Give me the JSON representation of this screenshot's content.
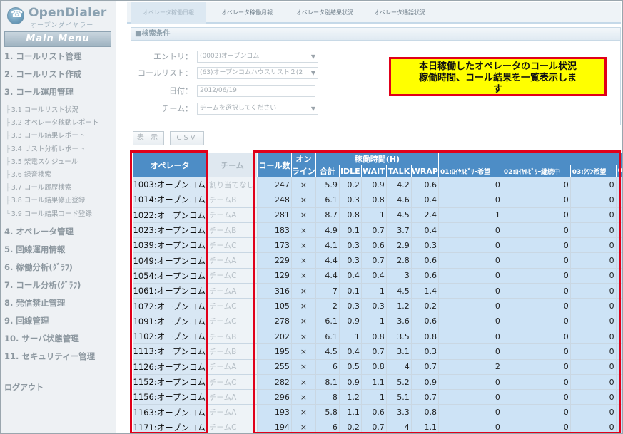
{
  "logo": {
    "name": "OpenDialer",
    "sub": "オープンダイヤラー"
  },
  "sidebar": {
    "main_menu": "Main Menu",
    "groups": [
      "1. コールリスト管理",
      "2. コールリスト作成",
      "3. コール運用管理",
      "4. オペレータ管理",
      "5. 回線運用情報",
      "6. 稼働分析(ｸﾞﾗﾌ)",
      "7. コール分析(ｸﾞﾗﾌ)",
      "8. 発信禁止管理",
      "9. 回線管理",
      "10. サーバ状態管理",
      "11. セキュリティー管理"
    ],
    "sub_items": [
      "3.1 コールリスト状況",
      "3.2 オペレータ稼動レポート",
      "3.3 コール結果レポート",
      "3.4 リスト分析レポート",
      "3.5 架電スケジュール",
      "3.6 録音検索",
      "3.7 コール履歴検索",
      "3.8 コール結果修正登録",
      "3.9 コール結果コード登録"
    ],
    "logout": "ログアウト"
  },
  "tabs": [
    "オペレータ稼働日報",
    "オペレータ稼働月報",
    "オペレータ別結果状況",
    "オペレータ通話状況"
  ],
  "search": {
    "header": "■検索条件",
    "entry_label": "エントリ：",
    "entry_value": "(0002)オープンコム",
    "list_label": "コールリスト：",
    "list_value": "(63)オープンコムハウスリスト２(2",
    "date_label": "日付：",
    "date_value": "2012/06/19",
    "team_label": "チーム：",
    "team_value": "チームを選択してください"
  },
  "buttons": {
    "display": "表 示",
    "csv": "CSV"
  },
  "callout": {
    "line1": "本日稼働したオペレータのコール状況",
    "line2": "稼働時間、コール結果を一覧表示しま",
    "line3": "す"
  },
  "table": {
    "headers": {
      "operator": "オペレータ",
      "team": "チーム",
      "calls": "コール数",
      "online_1": "オン",
      "online_2": "ライン",
      "uptime": "稼働時間(H)",
      "total": "合計",
      "idle": "IDLE",
      "wait": "WAIT",
      "talk": "TALK",
      "wrap": "WRAP",
      "r01": "01:ﾛｲﾔﾙﾋﾞﾘｰ希望",
      "r02": "02:ﾛｲﾔﾙﾋﾞﾘｰ継続中",
      "r03": "03:ｸﾜﾝ希望",
      "r04": "0"
    },
    "rows": [
      [
        "1003:オープンコム",
        "割り当てなし",
        "247",
        "×",
        "5.9",
        "0.2",
        "0.9",
        "4.2",
        "0.6",
        "0",
        "0",
        "0"
      ],
      [
        "1014:オープンコム",
        "チームB",
        "248",
        "×",
        "6.1",
        "0.3",
        "0.8",
        "4.6",
        "0.4",
        "0",
        "0",
        "0"
      ],
      [
        "1022:オープンコム",
        "チームA",
        "281",
        "×",
        "8.7",
        "0.8",
        "1",
        "4.5",
        "2.4",
        "1",
        "0",
        "0"
      ],
      [
        "1023:オープンコム",
        "チームB",
        "183",
        "×",
        "4.9",
        "0.1",
        "0.7",
        "3.7",
        "0.4",
        "0",
        "0",
        "0"
      ],
      [
        "1039:オープンコム",
        "チームC",
        "173",
        "×",
        "4.1",
        "0.3",
        "0.6",
        "2.9",
        "0.3",
        "0",
        "0",
        "0"
      ],
      [
        "1049:オープンコム",
        "チームA",
        "229",
        "×",
        "4.4",
        "0.3",
        "0.7",
        "2.8",
        "0.6",
        "0",
        "0",
        "0"
      ],
      [
        "1054:オープンコム",
        "チームC",
        "129",
        "×",
        "4.4",
        "0.4",
        "0.4",
        "3",
        "0.6",
        "0",
        "0",
        "0"
      ],
      [
        "1061:オープンコム",
        "チームA",
        "316",
        "×",
        "7",
        "0.1",
        "1",
        "4.5",
        "1.4",
        "0",
        "0",
        "0"
      ],
      [
        "1072:オープンコム",
        "チームC",
        "105",
        "×",
        "2",
        "0.3",
        "0.3",
        "1.2",
        "0.2",
        "0",
        "0",
        "0"
      ],
      [
        "1091:オープンコム",
        "チームC",
        "278",
        "×",
        "6.1",
        "0.9",
        "1",
        "3.6",
        "0.6",
        "0",
        "0",
        "0"
      ],
      [
        "1102:オープンコム",
        "チームB",
        "202",
        "×",
        "6.1",
        "1",
        "0.8",
        "3.5",
        "0.8",
        "0",
        "0",
        "0"
      ],
      [
        "1113:オープンコム",
        "チームB",
        "195",
        "×",
        "4.5",
        "0.4",
        "0.7",
        "3.1",
        "0.3",
        "0",
        "0",
        "0"
      ],
      [
        "1126:オープンコム",
        "チームA",
        "255",
        "×",
        "6",
        "0.5",
        "0.8",
        "4",
        "0.7",
        "2",
        "0",
        "0"
      ],
      [
        "1152:オープンコム",
        "チームC",
        "282",
        "×",
        "8.1",
        "0.9",
        "1.1",
        "5.2",
        "0.9",
        "0",
        "0",
        "0"
      ],
      [
        "1156:オープンコム",
        "チームA",
        "296",
        "×",
        "8",
        "1.2",
        "1",
        "5.1",
        "0.7",
        "0",
        "0",
        "0"
      ],
      [
        "1163:オープンコム",
        "チームA",
        "193",
        "×",
        "5.8",
        "1.1",
        "0.6",
        "3.3",
        "0.8",
        "0",
        "0",
        "0"
      ],
      [
        "1171:オープンコム",
        "チームC",
        "194",
        "×",
        "6",
        "0.2",
        "0.7",
        "4",
        "1.1",
        "0",
        "0",
        "0"
      ]
    ]
  },
  "colors": {
    "header_blue": "#4d8dc6",
    "highlight_red": "#e0001a",
    "callout_yellow": "#ffff00"
  }
}
